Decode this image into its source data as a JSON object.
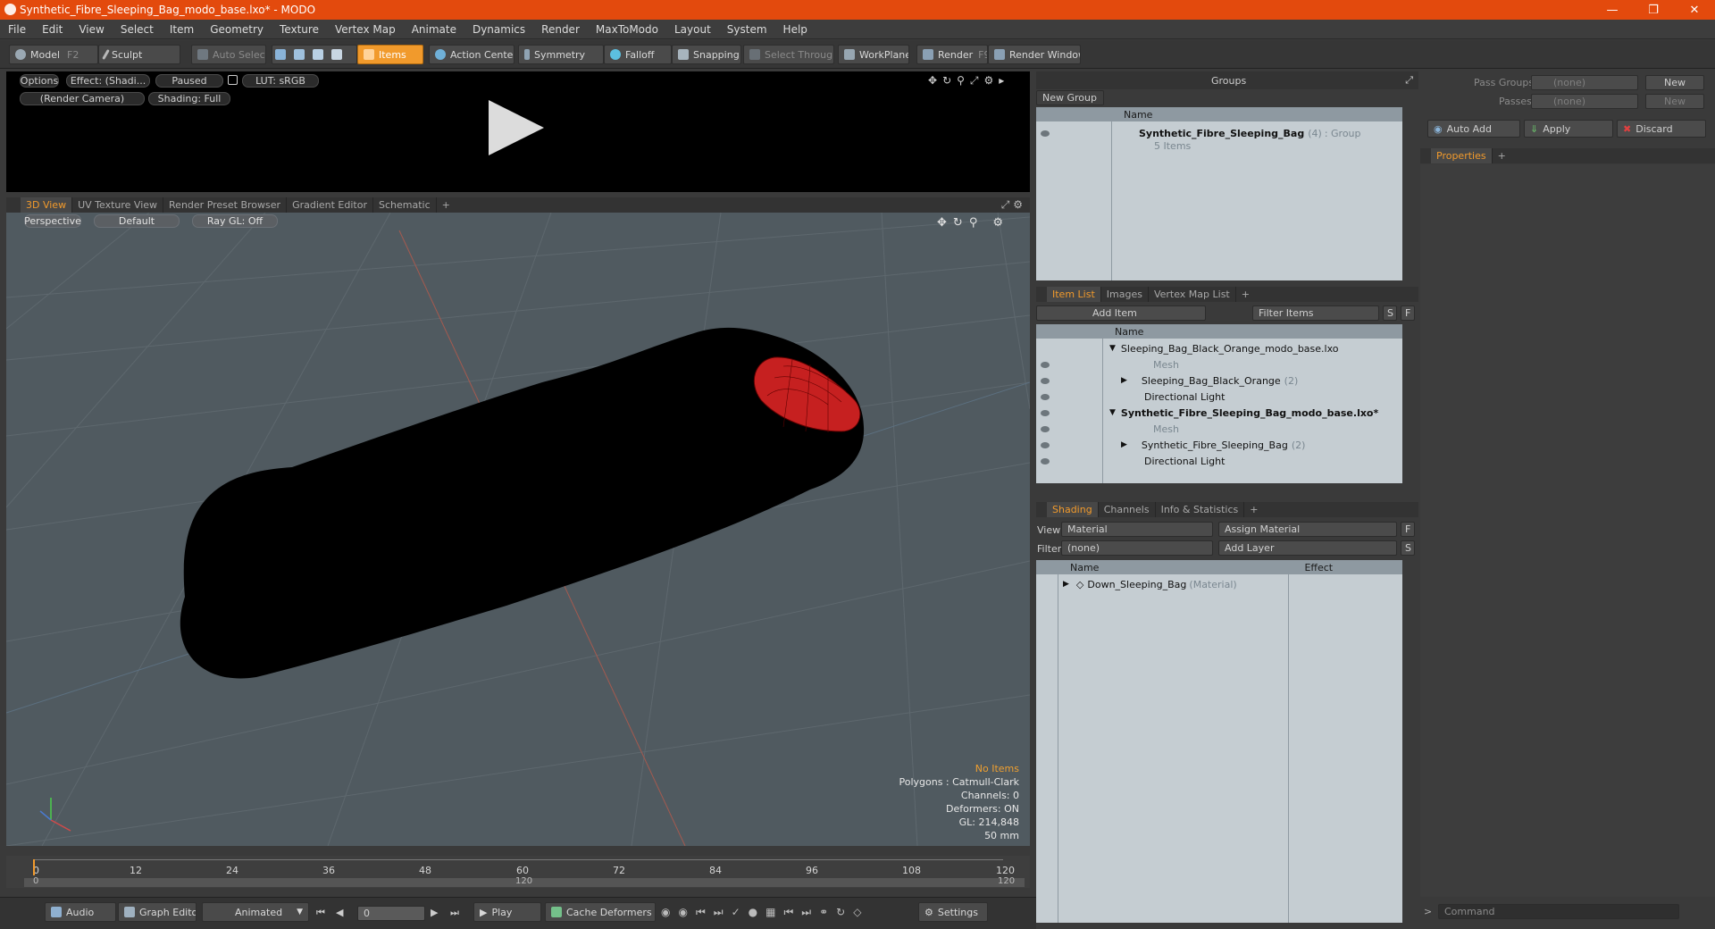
{
  "window": {
    "title": "Synthetic_Fibre_Sleeping_Bag_modo_base.lxo* - MODO"
  },
  "menu": [
    "File",
    "Edit",
    "View",
    "Select",
    "Item",
    "Geometry",
    "Texture",
    "Vertex Map",
    "Animate",
    "Dynamics",
    "Render",
    "MaxToModo",
    "Layout",
    "System",
    "Help"
  ],
  "toolbar": {
    "model": "Model",
    "model_key": "F2",
    "sculpt": "Sculpt",
    "auto_select": "Auto Select",
    "items": "Items",
    "action_center": "Action Center",
    "symmetry": "Symmetry",
    "falloff": "Falloff",
    "snapping": "Snapping",
    "select_through": "Select Through",
    "workplane": "WorkPlane",
    "render": "Render",
    "render_key": "F9",
    "render_window": "Render Window"
  },
  "render_preview": {
    "options": "Options",
    "effect": "Effect: (Shadi...",
    "paused": "Paused",
    "lut": "LUT: sRGB",
    "camera": "(Render Camera)",
    "shading": "Shading: Full"
  },
  "view_tabs": [
    "3D View",
    "UV Texture View",
    "Render Preset Browser",
    "Gradient Editor",
    "Schematic"
  ],
  "viewport": {
    "projection": "Perspective",
    "style": "Default",
    "raygl": "Ray GL: Off",
    "info": {
      "no_items": "No Items",
      "polygons": "Polygons : Catmull-Clark",
      "channels": "Channels: 0",
      "deformers": "Deformers: ON",
      "gl": "GL: 214,848",
      "units": "50 mm"
    }
  },
  "timeline": {
    "ticks": [
      "0",
      "12",
      "24",
      "36",
      "48",
      "60",
      "72",
      "84",
      "96",
      "108",
      "120"
    ],
    "range_start": "0",
    "range_mid": "120",
    "range_end": "120"
  },
  "bottombar": {
    "audio": "Audio",
    "graph_editor": "Graph Editor",
    "animated": "Animated",
    "frame": "0",
    "play": "Play",
    "cache_deformers": "Cache Deformers",
    "settings": "Settings"
  },
  "groups": {
    "title": "Groups",
    "new_group": "New Group",
    "col_name": "Name",
    "group_name": "Synthetic_Fibre_Sleeping_Bag",
    "group_count": "(4)",
    "group_type": ": Group",
    "group_items": "5 Items"
  },
  "item_list": {
    "tabs": [
      "Item List",
      "Images",
      "Vertex Map List"
    ],
    "add_item": "Add Item",
    "filter": "Filter Items",
    "s": "S",
    "f": "F",
    "col_name": "Name",
    "rows": [
      {
        "label": "Sleeping_Bag_Black_Orange_modo_base.lxo",
        "suffix": ""
      },
      {
        "label": "Mesh",
        "suffix": ""
      },
      {
        "label": "Sleeping_Bag_Black_Orange",
        "suffix": "(2)"
      },
      {
        "label": "Directional Light",
        "suffix": ""
      },
      {
        "label": "Synthetic_Fibre_Sleeping_Bag_modo_base.lxo*",
        "suffix": ""
      },
      {
        "label": "Mesh",
        "suffix": ""
      },
      {
        "label": "Synthetic_Fibre_Sleeping_Bag",
        "suffix": "(2)"
      },
      {
        "label": "Directional Light",
        "suffix": ""
      }
    ]
  },
  "shading": {
    "tabs": [
      "Shading",
      "Channels",
      "Info & Statistics"
    ],
    "view_label": "View",
    "view_value": "Material",
    "assign": "Assign Material",
    "f": "F",
    "filter_label": "Filter",
    "filter_value": "(none)",
    "add_layer": "Add Layer",
    "s": "S",
    "col_name": "Name",
    "col_effect": "Effect",
    "material": "Down_Sleeping_Bag",
    "material_type": "(Material)"
  },
  "properties": {
    "pass_groups": "Pass Groups",
    "passes": "Passes",
    "none": "(none)",
    "new": "New",
    "auto_add": "Auto Add",
    "apply": "Apply",
    "discard": "Discard",
    "tab": "Properties",
    "command": "Command"
  }
}
